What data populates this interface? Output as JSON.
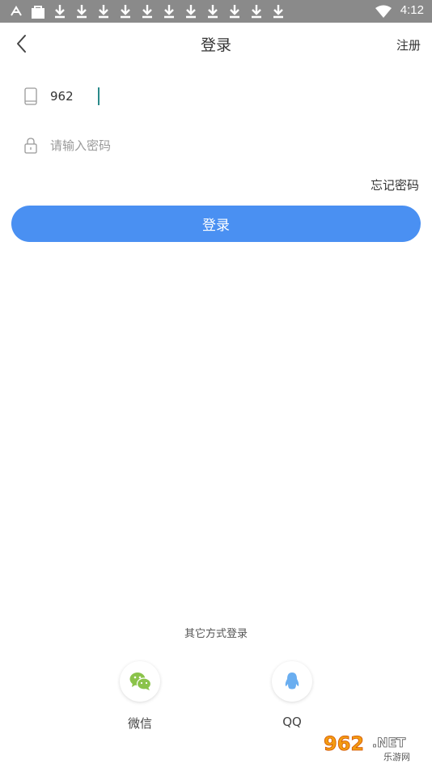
{
  "status_bar": {
    "time": "4:12",
    "icons": [
      "android-notification-icon",
      "bag-icon",
      "download-icon",
      "download-icon",
      "download-icon",
      "download-icon",
      "download-icon",
      "download-icon",
      "download-icon",
      "download-icon",
      "download-icon",
      "download-icon",
      "download-icon",
      "wifi-icon",
      "battery-icon"
    ],
    "background": "#8a8a8a"
  },
  "nav": {
    "back_icon": "chevron-left-icon",
    "title": "登录",
    "register_label": "注册"
  },
  "form": {
    "phone": {
      "icon": "phone-icon",
      "value": "962",
      "placeholder": ""
    },
    "password": {
      "icon": "lock-icon",
      "value": "",
      "placeholder": "请输入密码"
    },
    "forgot_label": "忘记密码",
    "login_label": "登录",
    "accent": "#4a90f2"
  },
  "other_login": {
    "label": "其它方式登录",
    "options": [
      {
        "label": "微信",
        "icon": "wechat-icon",
        "color": "#8bc34a"
      },
      {
        "label": "QQ",
        "icon": "qq-icon",
        "color": "#6aaef0"
      }
    ]
  },
  "watermark": {
    "brand": "962",
    "suffix": ".NET",
    "subtitle": "乐游网"
  }
}
